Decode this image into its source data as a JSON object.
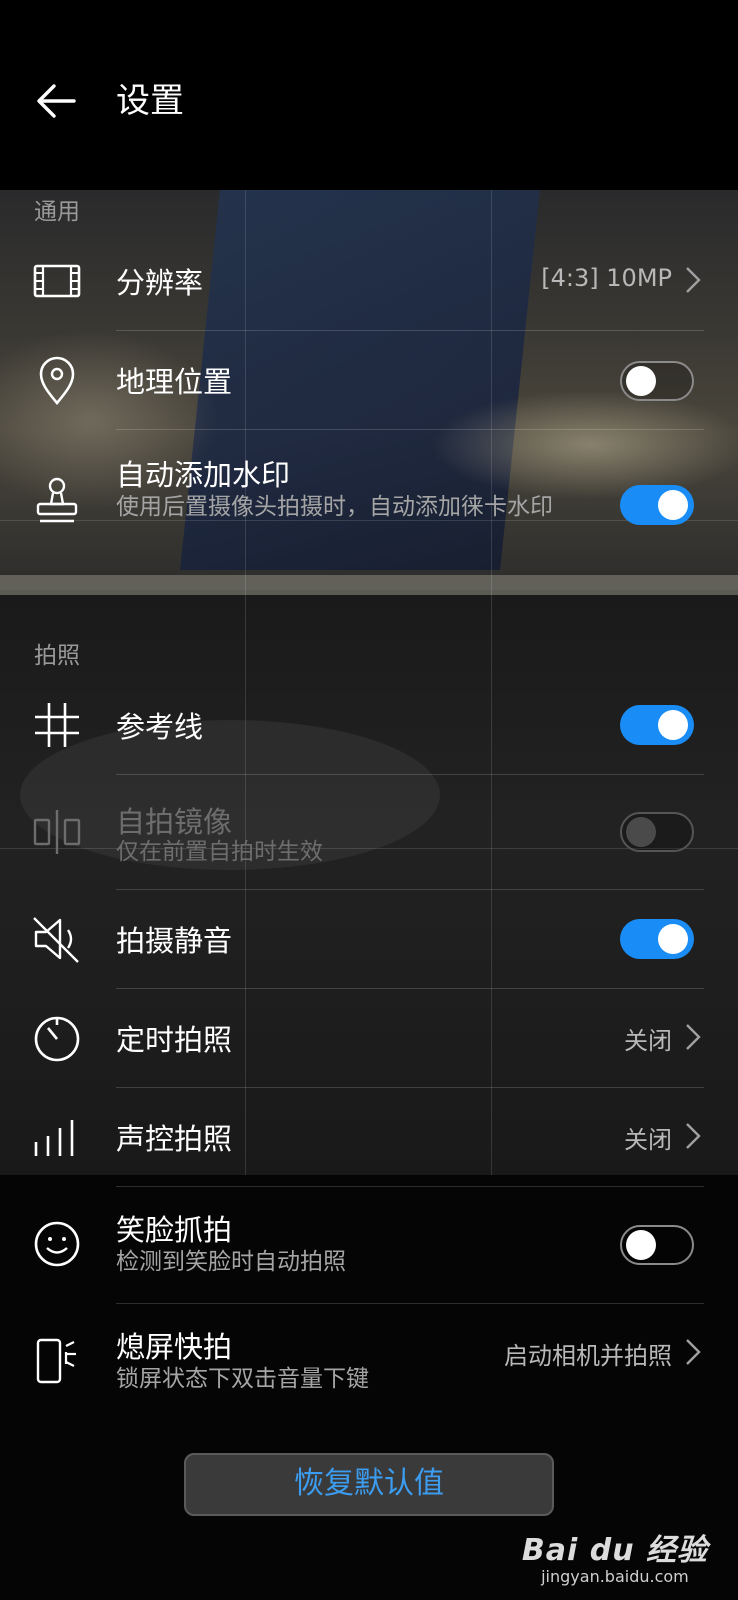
{
  "header": {
    "title": "设置"
  },
  "sections": {
    "general": "通用",
    "photo": "拍照"
  },
  "rows": {
    "resolution": {
      "label": "分辨率",
      "value": "[4:3] 10MP"
    },
    "location": {
      "label": "地理位置",
      "toggle": false
    },
    "watermark": {
      "label": "自动添加水印",
      "sub": "使用后置摄像头拍摄时，自动添加徕卡水印",
      "toggle": true
    },
    "grid": {
      "label": "参考线",
      "toggle": true
    },
    "mirror": {
      "label": "自拍镜像",
      "sub": "仅在前置自拍时生效",
      "toggle": false,
      "disabled": true
    },
    "mute": {
      "label": "拍摄静音",
      "toggle": true
    },
    "timer": {
      "label": "定时拍照",
      "value": "关闭"
    },
    "voice": {
      "label": "声控拍照",
      "value": "关闭"
    },
    "smile": {
      "label": "笑脸抓拍",
      "sub": "检测到笑脸时自动拍照",
      "toggle": false
    },
    "ultrasnap": {
      "label": "熄屏快拍",
      "sub": "锁屏状态下双击音量下键",
      "value": "启动相机并拍照"
    }
  },
  "reset_button": "恢复默认值",
  "watermark_logo": {
    "brand": "Bai du 经验",
    "site": "jingyan.baidu.com"
  },
  "colors": {
    "accent": "#1a8cf5",
    "reset_text": "#3c9cf0",
    "background": "#000000"
  }
}
